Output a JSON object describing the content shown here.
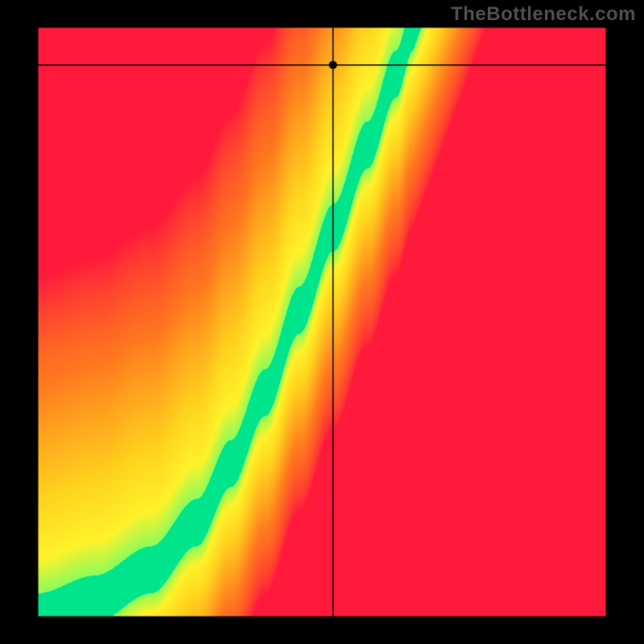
{
  "watermark": "TheBottleneck.com",
  "chart_data": {
    "type": "heatmap",
    "title": "",
    "xlabel": "",
    "ylabel": "",
    "xlim": [
      0,
      1
    ],
    "ylim": [
      0,
      1
    ],
    "crosshair": {
      "x": 0.52,
      "y": 0.935
    },
    "marker": {
      "x": 0.52,
      "y": 0.935
    },
    "color_scale": {
      "stops": [
        {
          "value": 0.0,
          "color": "#ff1a3c"
        },
        {
          "value": 0.45,
          "color": "#ff7a1e"
        },
        {
          "value": 0.72,
          "color": "#ffd21e"
        },
        {
          "value": 0.85,
          "color": "#fff22a"
        },
        {
          "value": 0.95,
          "color": "#5dff6e"
        },
        {
          "value": 1.0,
          "color": "#00e48c"
        }
      ]
    },
    "optimal_curve": [
      {
        "x": 0.0,
        "y": 0.0
      },
      {
        "x": 0.1,
        "y": 0.03
      },
      {
        "x": 0.2,
        "y": 0.08
      },
      {
        "x": 0.28,
        "y": 0.16
      },
      {
        "x": 0.34,
        "y": 0.26
      },
      {
        "x": 0.4,
        "y": 0.38
      },
      {
        "x": 0.46,
        "y": 0.52
      },
      {
        "x": 0.52,
        "y": 0.66
      },
      {
        "x": 0.58,
        "y": 0.8
      },
      {
        "x": 0.63,
        "y": 0.92
      },
      {
        "x": 0.66,
        "y": 1.0
      }
    ],
    "band_halfwidth": 0.04,
    "corner_hue_bias": {
      "top_left": "red",
      "bottom_right": "red",
      "top_right": "yellow",
      "bottom_left": "green-start"
    }
  }
}
